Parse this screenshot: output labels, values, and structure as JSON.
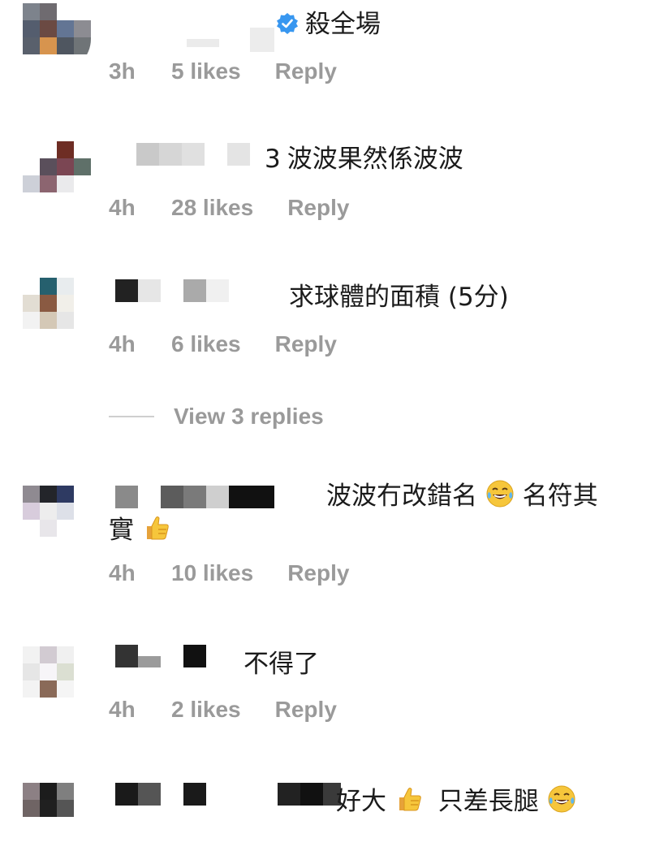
{
  "comments": [
    {
      "text": "殺全場",
      "time": "3h",
      "likes": "5 likes",
      "reply": "Reply",
      "verified": true
    },
    {
      "prefix": "3",
      "text": "波波果然係波波",
      "time": "4h",
      "likes": "28 likes",
      "reply": "Reply"
    },
    {
      "text": "求球體的面積 (5分)",
      "time": "4h",
      "likes": "6 likes",
      "reply": "Reply"
    },
    {
      "text_a": "波波冇改錯名",
      "text_b": "名符其",
      "text_c": "實",
      "time": "4h",
      "likes": "10 likes",
      "reply": "Reply"
    },
    {
      "text": "不得了",
      "time": "4h",
      "likes": "2 likes",
      "reply": "Reply"
    },
    {
      "text_a": "好大",
      "text_b": "只差長腿",
      "time": "",
      "likes": "",
      "reply": ""
    }
  ],
  "view_replies": "View 3 replies",
  "colors": {
    "meta_gray": "#9a9a9a",
    "verified_blue": "#3897f0",
    "text": "#1b1b1b"
  },
  "icons": [
    "verified-badge-icon",
    "laughing-tears-emoji-icon",
    "thumbs-up-emoji-icon"
  ]
}
